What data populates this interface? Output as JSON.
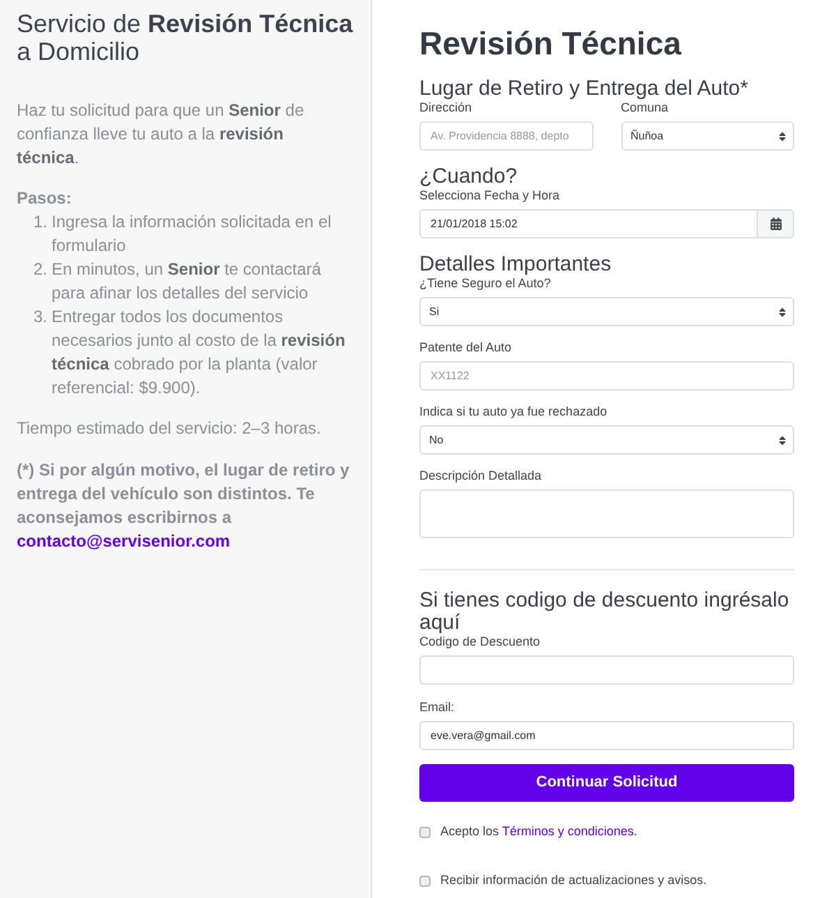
{
  "intro": {
    "title": "Servicio de **Revisión Técnica** a Domicilio",
    "description": "Haz tu solicitud para que un **Senior** de confianza lleve tu auto a la **revisión técnica**.",
    "steps_heading": "Pasos:",
    "steps": [
      {
        "number": "1.",
        "text": "Ingresa la información solicitada en el formulario"
      },
      {
        "number": "2.",
        "text": "En minutos, un **Senior** te contactará para afinar los detalles del servicio"
      },
      {
        "number": "3.",
        "text": "Entregar todos los documentos necesarios junto al costo de la **revisión técnica** cobrado por la planta (valor referencial: $9.900)."
      }
    ],
    "duration": "Tiempo estimado del servicio: 2–3 horas.",
    "note": "(*) Si por algún motivo, el lugar de retiro y entrega del vehículo son distintos. Te aconsejamos escribirnos a",
    "contact_link": "contacto@servisenior.com"
  },
  "form": {
    "title": "Revisión Técnica",
    "sections": [
      {
        "heading": "Lugar de Retiro y Entrega del Auto*",
        "rows": [
          [
            {
              "kind": "text",
              "label": "Dirección",
              "placeholder": "Av. Providencia 8888, depto"
            },
            {
              "kind": "select",
              "label": "Comuna",
              "value": "Ñuñoa"
            }
          ]
        ]
      },
      {
        "heading": "¿Cuando?",
        "rows": [
          [
            {
              "kind": "date",
              "label": "Selecciona Fecha y Hora",
              "value": "21/01/2018 15:02"
            }
          ]
        ]
      },
      {
        "heading": "Detalles Importantes",
        "rows": [
          [
            {
              "kind": "select",
              "label": "¿Tiene Seguro el Auto?",
              "value": "Si"
            }
          ],
          [
            {
              "kind": "text",
              "label": "Patente del Auto",
              "placeholder": "XX1122"
            }
          ],
          [
            {
              "kind": "select",
              "label": "Indica si tu auto ya fue rechazado",
              "value": "No"
            }
          ],
          [
            {
              "kind": "textarea",
              "label": "Descripción Detallada"
            }
          ]
        ]
      }
    ],
    "discount": {
      "heading": "Si tienes codigo de descuento ingrésalo aquí",
      "fields": [
        {
          "kind": "text",
          "label": "Codigo de Descuento"
        },
        {
          "kind": "text",
          "label": "Email:",
          "value": "eve.vera@gmail.com"
        }
      ]
    },
    "submit_button": "Continuar Solicitud",
    "options": [
      {
        "label": "Acepto los",
        "link": "Términos y condiciones.",
        "checked": false
      },
      {
        "label": "Recibir información de actualizaciones y avisos.",
        "checked": false
      }
    ]
  }
}
